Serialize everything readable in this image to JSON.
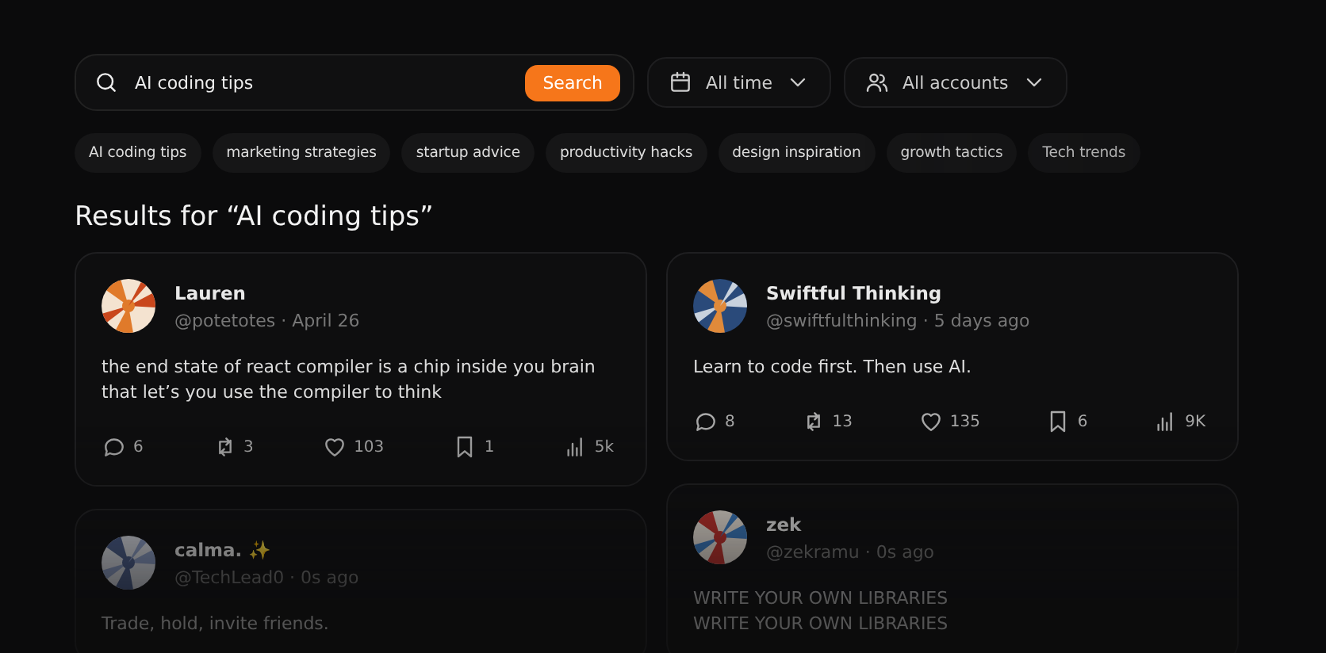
{
  "search": {
    "value": "AI coding tips",
    "button": "Search"
  },
  "filters": [
    {
      "kind": "date",
      "label": "All time"
    },
    {
      "kind": "accounts",
      "label": "All accounts"
    }
  ],
  "chips": [
    "AI coding tips",
    "marketing strategies",
    "startup advice",
    "productivity hacks",
    "design inspiration",
    "growth tactics",
    "Tech trends"
  ],
  "heading": "Results for “AI coding tips”",
  "columns": [
    [
      {
        "name": "Lauren",
        "meta": "@potetotes · April 26",
        "text": "the end state of react compiler is a chip inside you brain that let’s you use the compiler to think",
        "stats": {
          "replies": "6",
          "reposts": "3",
          "likes": "103",
          "bookmarks": "1",
          "views": "5k"
        }
      },
      {
        "name": "calma. ✨",
        "meta": "@TechLead0 · 0s ago",
        "text": "Trade, hold, invite friends."
      }
    ],
    [
      {
        "name": "Swiftful Thinking",
        "meta": "@swiftfulthinking · 5 days ago",
        "text": "Learn to code first. Then use AI.",
        "stats": {
          "replies": "8",
          "reposts": "13",
          "likes": "135",
          "bookmarks": "6",
          "views": "9K"
        }
      },
      {
        "name": "zek",
        "meta": "@zekramu · 0s ago",
        "text": "WRITE YOUR OWN LIBRARIES\nWRITE YOUR OWN LIBRARIES"
      }
    ]
  ]
}
